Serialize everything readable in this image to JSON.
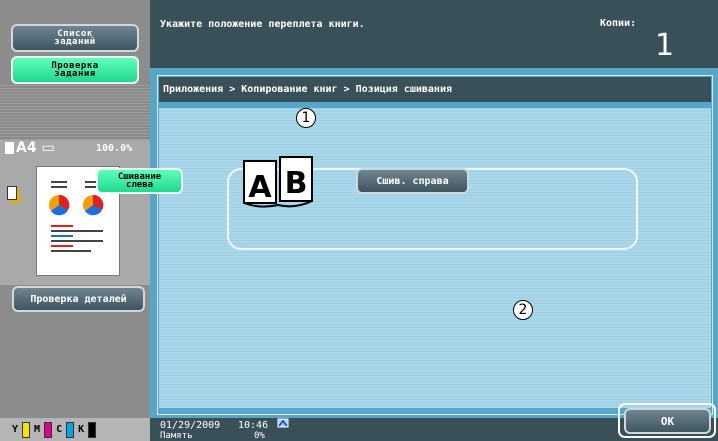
{
  "left_panel": {
    "jobs_button": "Список\nзаданий",
    "check_button": "Проверка\nзадания",
    "paper_size": "A4",
    "zoom": "100.0%",
    "details_button": "Проверка деталей",
    "toner": [
      "Y",
      "M",
      "C",
      "K"
    ]
  },
  "header": {
    "message": "Укажите положение переплета книги.",
    "copies_label": "Копии:",
    "copies_value": "1"
  },
  "breadcrumb": "Приложения > Копирование книг > Позиция сшивания",
  "options": {
    "left_label": "Сшивание\nслева",
    "right_label": "Сшив. справа",
    "book_letters": [
      "A",
      "B"
    ]
  },
  "callouts": [
    "1",
    "2"
  ],
  "footer": {
    "date": "01/29/2009",
    "time": "10:46",
    "memory_label": "Память",
    "memory_value": "0%",
    "ok_button": "OK"
  },
  "colors": {
    "panel_dark": "#3a5058",
    "main_blue": "#56a6c8",
    "green_button": "#2fe59a",
    "toner_y": "#f2e600",
    "toner_m": "#e0008c",
    "toner_c": "#00a6e0",
    "toner_k": "#000000"
  }
}
